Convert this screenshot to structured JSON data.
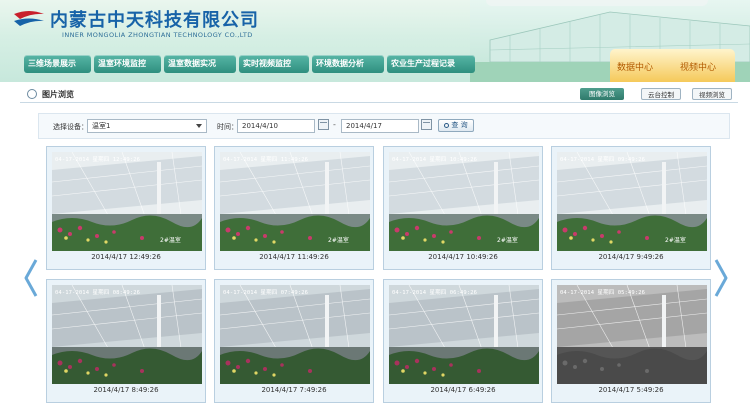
{
  "header": {
    "company_cn": "内蒙古中天科技有限公司",
    "company_en": "INNER MONGOLIA ZHONGTIAN TECHNOLOGY CO.,LTD"
  },
  "nav": [
    "三维场景展示",
    "温室环境监控",
    "温室数据实况",
    "实时视频监控",
    "环境数据分析",
    "农业生产过程记录"
  ],
  "tabs": {
    "data_center": "数据中心",
    "video_center": "视频中心"
  },
  "page": {
    "title": "图片浏览",
    "buttons": {
      "browse": "图像浏览",
      "ptz": "云台控制",
      "video": "视频浏览"
    }
  },
  "filter": {
    "device_label": "选择设备：",
    "device_value": "温室1",
    "time_label": "时间：",
    "date_from": "2014/4/10",
    "date_to": "2014/4/17",
    "separator": "-",
    "query_label": "查 询"
  },
  "images": [
    {
      "stamp": "04-17-2014 星期四 12:49:26",
      "watermark": "2#温室",
      "caption": "2014/4/17 12:49:26",
      "style": "day"
    },
    {
      "stamp": "04-17-2014 星期四 11:49:26",
      "watermark": "2#温室",
      "caption": "2014/4/17 11:49:26",
      "style": "day"
    },
    {
      "stamp": "04-17-2014 星期四 10:49:26",
      "watermark": "2#温室",
      "caption": "2014/4/17 10:49:26",
      "style": "day"
    },
    {
      "stamp": "04-17-2014 星期四 09:49:26",
      "watermark": "2#温室",
      "caption": "2014/4/17 9:49:26",
      "style": "day"
    },
    {
      "stamp": "04-17-2014 星期四 08:49:26",
      "watermark": "",
      "caption": "2014/4/17 8:49:26",
      "style": "dim"
    },
    {
      "stamp": "04-17-2014 星期四 07:49:26",
      "watermark": "",
      "caption": "2014/4/17 7:49:26",
      "style": "dim"
    },
    {
      "stamp": "04-17-2014 星期四 06:49:26",
      "watermark": "",
      "caption": "2014/4/17 6:49:26",
      "style": "dim"
    },
    {
      "stamp": "04-17-2014 星期四 05:49:26",
      "watermark": "",
      "caption": "2014/4/17 5:49:26",
      "style": "night"
    }
  ],
  "colors": {
    "brand_blue": "#1763a8",
    "nav_green": "#2f8f7f",
    "tab_gold": "#f5c95a",
    "arrow_blue": "#6aa9d8"
  }
}
